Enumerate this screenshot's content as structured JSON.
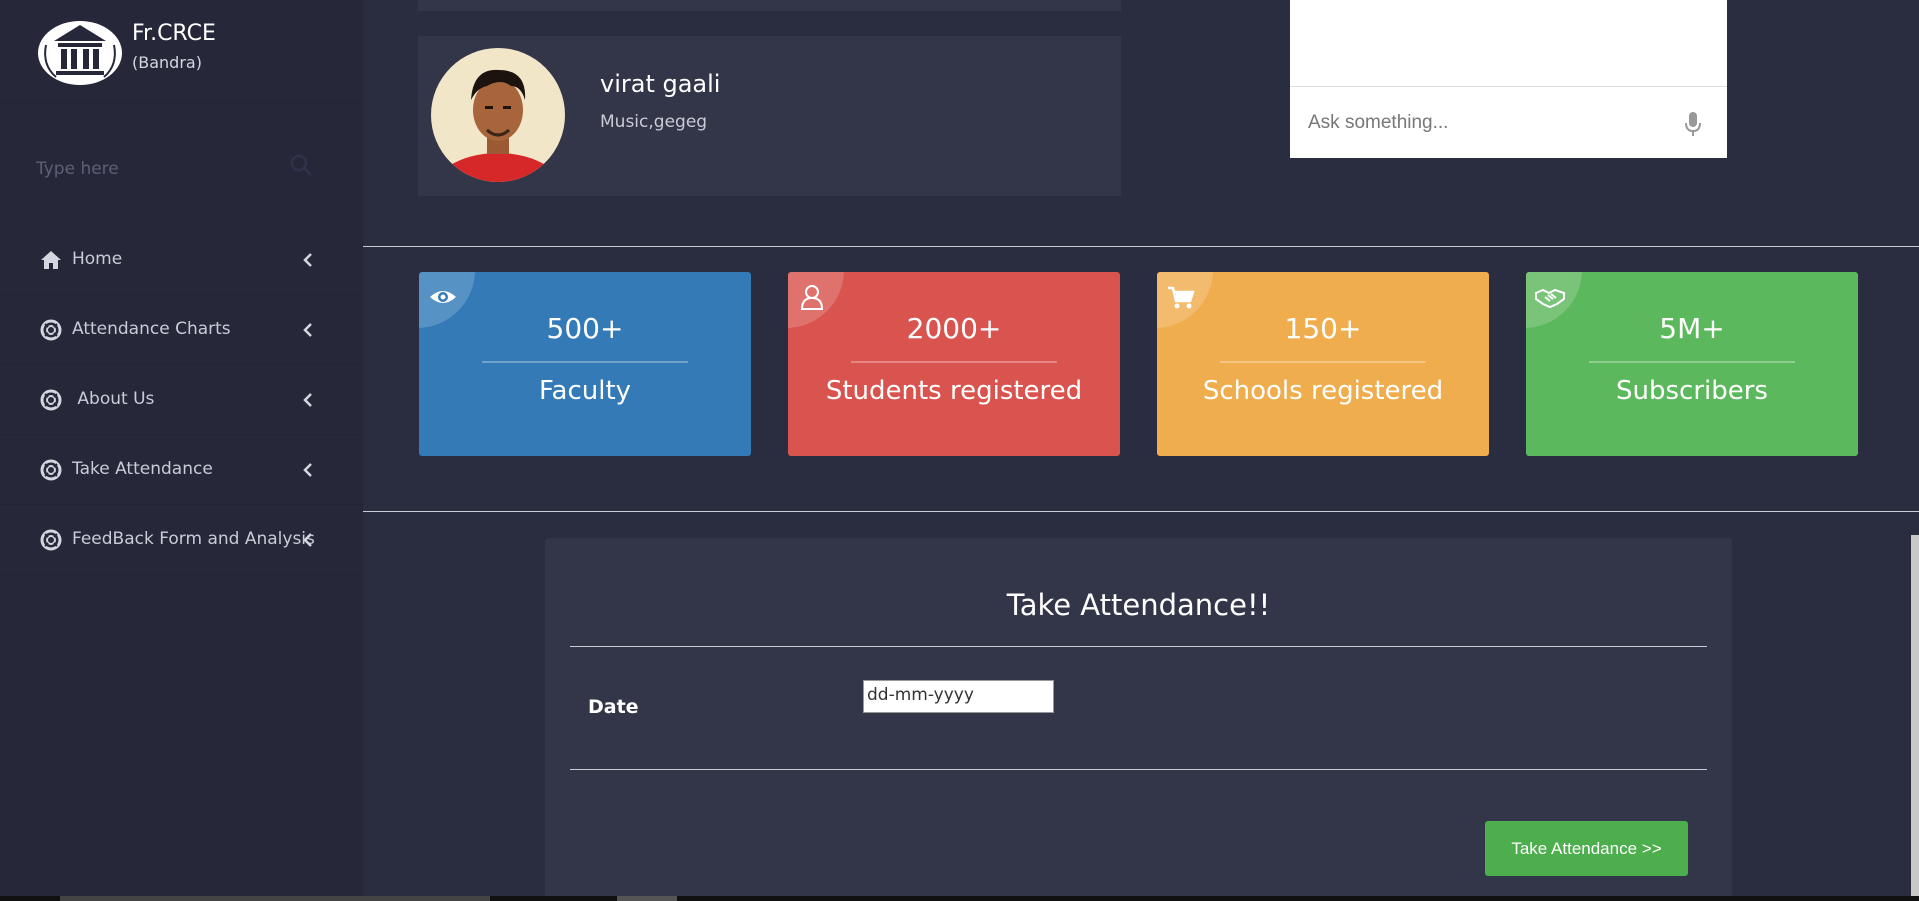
{
  "brand": {
    "name": "Fr.CRCE",
    "sub": "(Bandra)"
  },
  "search": {
    "placeholder": "Type here"
  },
  "menu": [
    {
      "label": "Home",
      "icon": "home-icon"
    },
    {
      "label": "Attendance Charts",
      "icon": "lifebuoy-icon"
    },
    {
      "label": " About Us",
      "icon": "lifebuoy-icon"
    },
    {
      "label": "Take Attendance",
      "icon": "lifebuoy-icon"
    },
    {
      "label": "FeedBack Form and Analysis",
      "icon": "lifebuoy-icon"
    }
  ],
  "profile": {
    "name": "virat gaali",
    "sub": "Music,gegeg"
  },
  "chat": {
    "placeholder": "Ask something..."
  },
  "stats": [
    {
      "value": "500+",
      "label": "Faculty",
      "color": "#337ab7",
      "icon": "eye-icon"
    },
    {
      "value": "2000+",
      "label": "Students registered",
      "color": "#d9534f",
      "icon": "user-icon"
    },
    {
      "value": "150+",
      "label": "Schools registered",
      "color": "#f0ad4e",
      "icon": "cart-icon"
    },
    {
      "value": "5M+",
      "label": "Subscribers",
      "color": "#5cb85c",
      "icon": "handshake-icon"
    }
  ],
  "attendance": {
    "title": "Take Attendance!!",
    "date_label": "Date",
    "date_placeholder": "dd-mm-yyyy",
    "button": "Take Attendance >>"
  }
}
